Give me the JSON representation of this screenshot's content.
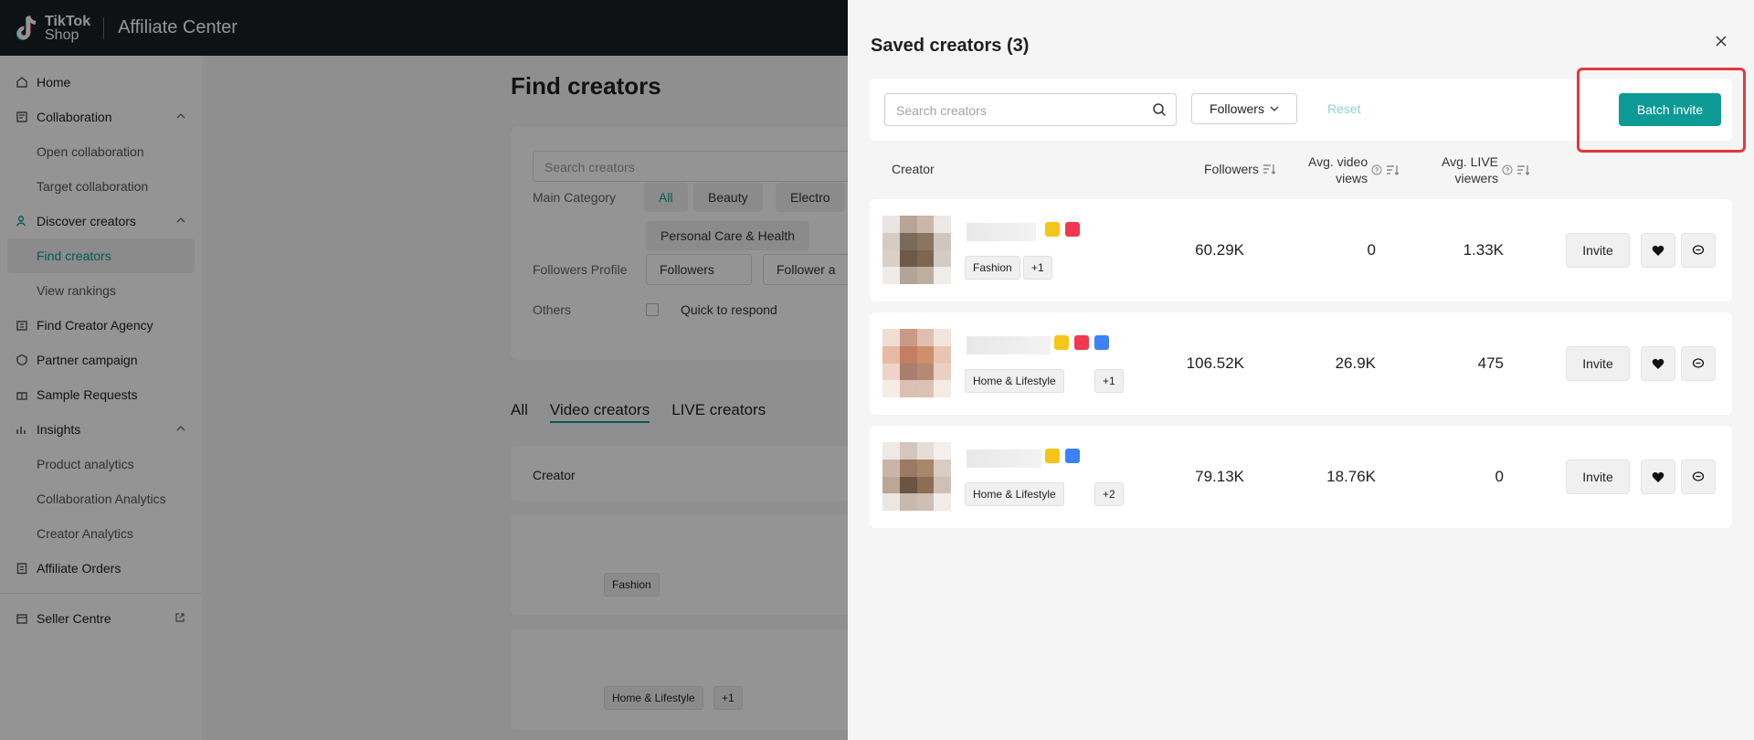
{
  "header": {
    "brand_top": "TikTok",
    "brand_bottom": "Shop",
    "app_title": "Affiliate Center"
  },
  "sidebar": {
    "items": [
      {
        "label": "Home",
        "icon": "home-icon"
      },
      {
        "label": "Collaboration",
        "icon": "collaboration-icon",
        "expanded": true
      },
      {
        "label": "Open collaboration",
        "sub": true
      },
      {
        "label": "Target collaboration",
        "sub": true
      },
      {
        "label": "Discover creators",
        "icon": "creators-icon",
        "expanded": true
      },
      {
        "label": "Find creators",
        "sub": true,
        "active": true
      },
      {
        "label": "View rankings",
        "sub": true
      },
      {
        "label": "Find Creator Agency",
        "icon": "agency-icon"
      },
      {
        "label": "Partner campaign",
        "icon": "campaign-icon"
      },
      {
        "label": "Sample Requests",
        "icon": "gift-icon"
      },
      {
        "label": "Insights",
        "icon": "insights-icon",
        "expanded": true
      },
      {
        "label": "Product analytics",
        "sub": true
      },
      {
        "label": "Collaboration Analytics",
        "sub": true
      },
      {
        "label": "Creator Analytics",
        "sub": true
      },
      {
        "label": "Affiliate Orders",
        "icon": "orders-icon"
      }
    ],
    "seller_centre": "Seller Centre"
  },
  "page": {
    "title": "Find creators",
    "search_placeholder": "Search creators",
    "main_category_label": "Main Category",
    "categories": [
      "All",
      "Beauty",
      "Electro",
      "Personal Care & Health"
    ],
    "followers_profile_label": "Followers Profile",
    "followers_select": "Followers",
    "follower_age_select": "Follower a",
    "others_label": "Others",
    "quick_respond": "Quick to respond",
    "tabs": [
      "All",
      "Video creators",
      "LIVE creators"
    ],
    "table_creator_header": "Creator",
    "bg_rows": [
      {
        "tags": [
          "Fashion"
        ]
      },
      {
        "tags": [
          "Home & Lifestyle",
          "+1"
        ]
      }
    ]
  },
  "drawer": {
    "title": "Saved creators (3)",
    "search_placeholder": "Search creators",
    "followers_filter": "Followers",
    "reset": "Reset",
    "batch_invite": "Batch invite",
    "columns": {
      "creator": "Creator",
      "followers": "Followers",
      "avg_video_views_1": "Avg. video",
      "avg_video_views_2": "views",
      "avg_live_viewers_1": "Avg. LIVE",
      "avg_live_viewers_2": "viewers"
    },
    "rows": [
      {
        "tag": "Fashion",
        "extra": "+1",
        "followers": "60.29K",
        "video_views": "0",
        "live_viewers": "1.33K",
        "invite": "Invite"
      },
      {
        "tag": "Home & Lifestyle",
        "extra": "+1",
        "followers": "106.52K",
        "video_views": "26.9K",
        "live_viewers": "475",
        "invite": "Invite"
      },
      {
        "tag": "Home & Lifestyle",
        "extra": "+2",
        "followers": "79.13K",
        "video_views": "18.76K",
        "live_viewers": "0",
        "invite": "Invite"
      }
    ]
  },
  "colors": {
    "accent": "#0d9a94",
    "highlight": "#e5383b",
    "header_bg": "#1b1f24"
  }
}
